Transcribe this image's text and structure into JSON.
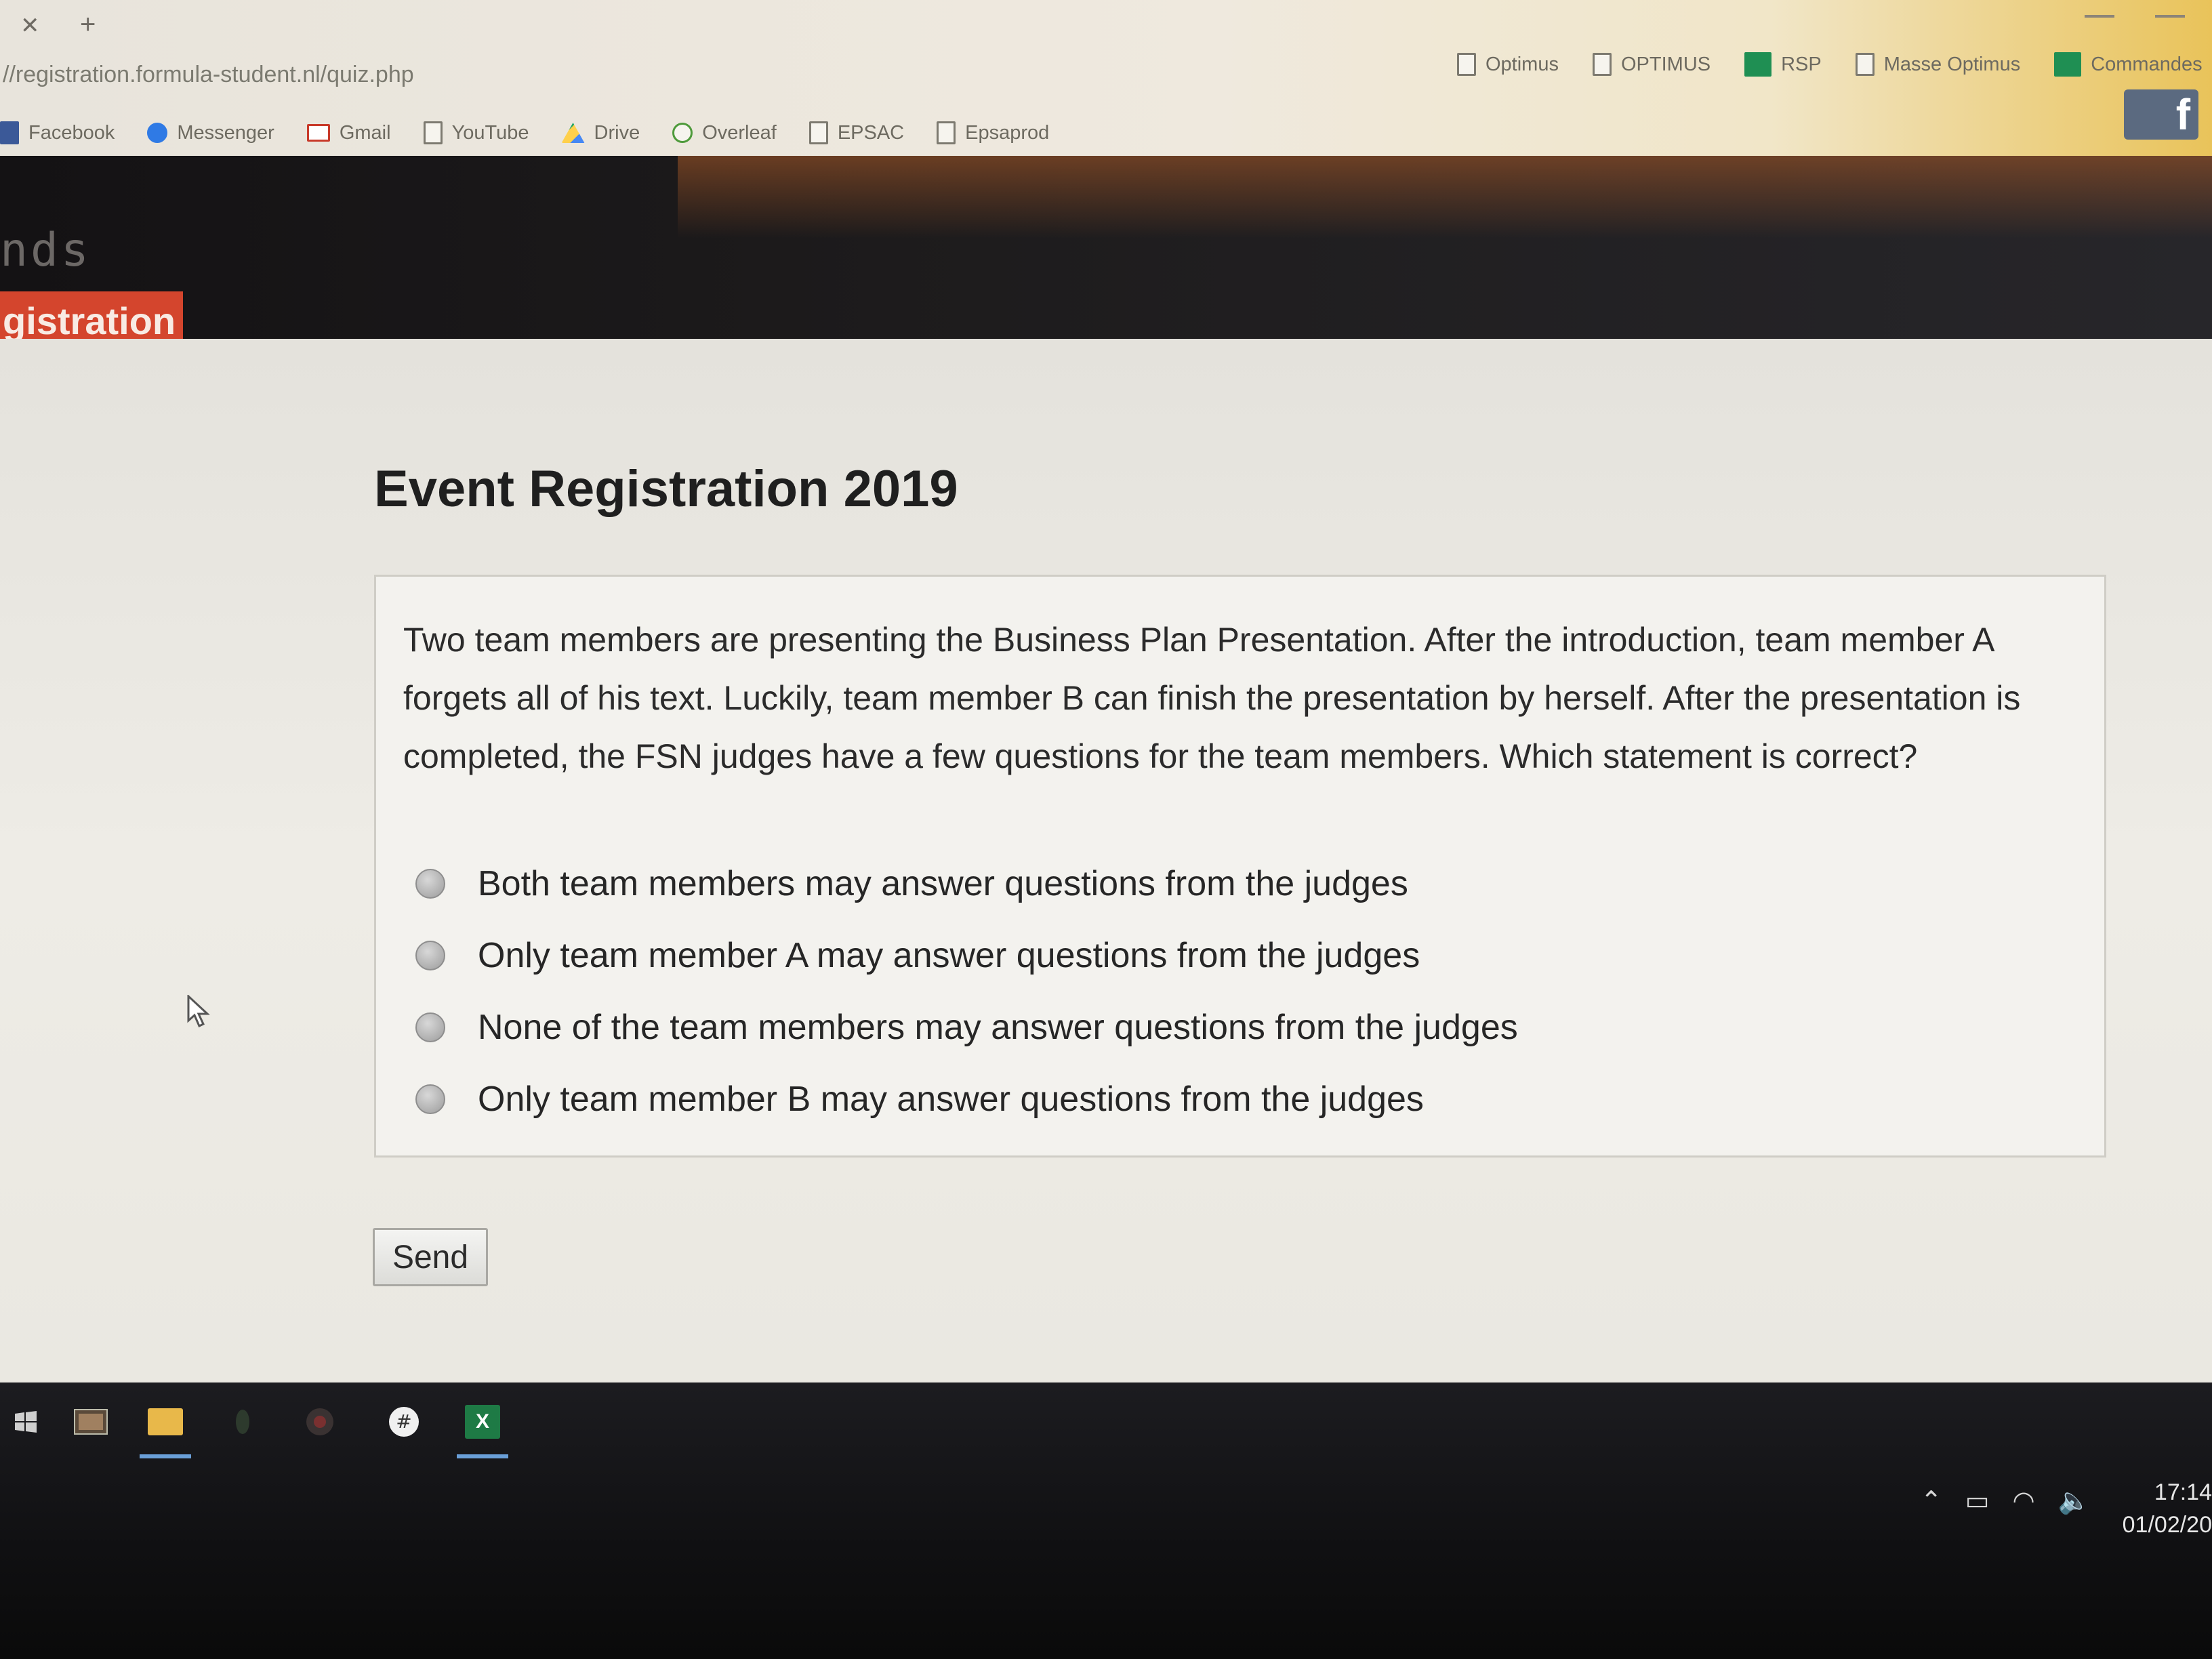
{
  "browser": {
    "address": "//registration.formula-student.nl/quiz.php",
    "bookmarks_top": [
      {
        "label": "Optimus",
        "icon": "page-icon"
      },
      {
        "label": "OPTIMUS",
        "icon": "page-icon"
      },
      {
        "label": "RSP",
        "icon": "sheet-icon"
      },
      {
        "label": "Masse Optimus",
        "icon": "page-icon"
      },
      {
        "label": "Commandes",
        "icon": "sheet-icon"
      }
    ],
    "bookmarks": [
      {
        "label": "Facebook",
        "icon": "facebook-icon"
      },
      {
        "label": "Messenger",
        "icon": "messenger-icon"
      },
      {
        "label": "Gmail",
        "icon": "gmail-icon"
      },
      {
        "label": "YouTube",
        "icon": "page-icon"
      },
      {
        "label": "Drive",
        "icon": "drive-icon"
      },
      {
        "label": "Overleaf",
        "icon": "overleaf-icon"
      },
      {
        "label": "EPSAC",
        "icon": "page-icon"
      },
      {
        "label": "Epsaprod",
        "icon": "page-icon"
      }
    ],
    "more_bookmarks": "»"
  },
  "site": {
    "brand": "nds",
    "active_nav": "gistration"
  },
  "quiz": {
    "title": "Event Registration 2019",
    "question": "Two team members are presenting the Business Plan Presentation. After the introduction, team member A forgets all of his text. Luckily, team member B can finish the presentation by herself. After the presentation is completed, the FSN judges have a few questions for the team members. Which statement is correct?",
    "options": [
      "Both team members may answer questions from the judges",
      "Only team member A may answer questions from the judges",
      "None of the team members may answer questions from the judges",
      "Only team member B may answer questions from the judges"
    ],
    "send_label": "Send"
  },
  "taskbar": {
    "time": "17:14",
    "date": "01/02/20"
  },
  "colors": {
    "accent": "#d4452d",
    "header_bg": "#1d1b1c",
    "content_bg": "#eceae4"
  }
}
